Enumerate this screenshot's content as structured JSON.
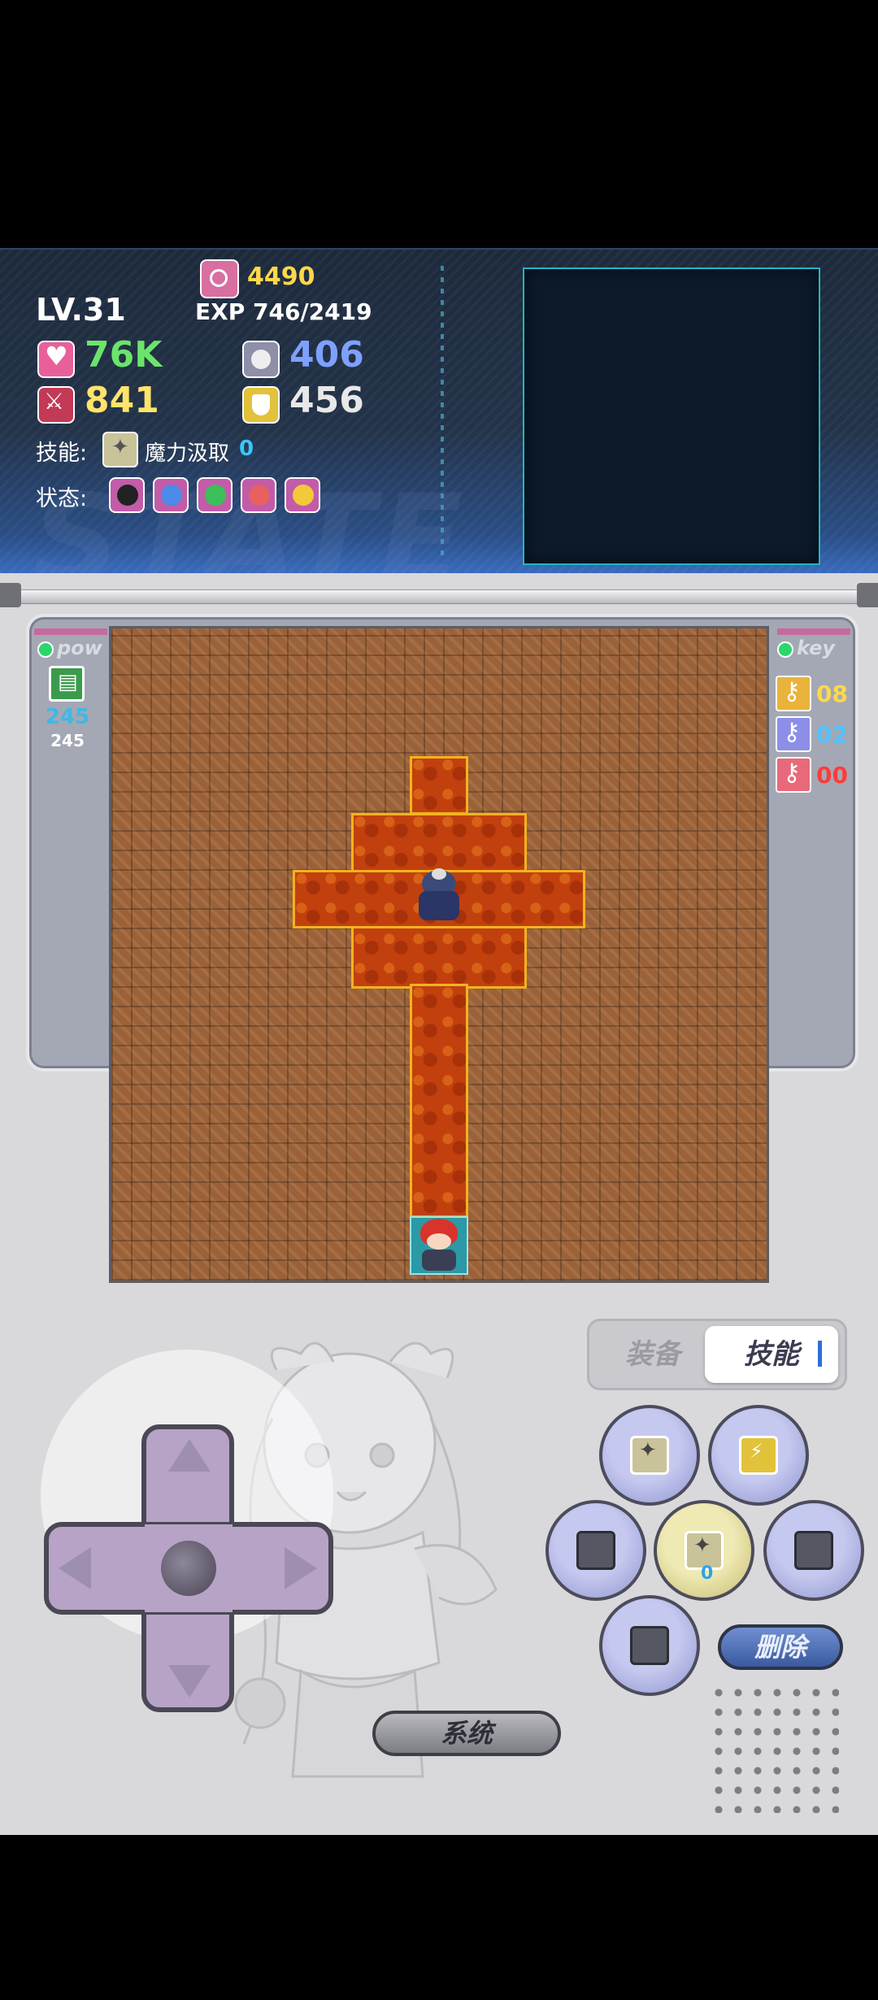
{
  "status": {
    "level": "LV.31",
    "gold": "4490",
    "exp": "EXP 746/2419",
    "hp": "76K",
    "mdef": "406",
    "atk": "841",
    "def": "456",
    "skill_label": "技能:",
    "skill_name": "魔力汲取",
    "skill_count": "0",
    "state_label": "状态:",
    "watermark": "STATE"
  },
  "side_left": {
    "title": "pow",
    "value_main": "245",
    "value_sub": "245"
  },
  "side_right": {
    "title": "key",
    "keys": [
      {
        "color": "#e9b33c",
        "count": "08",
        "count_color": "#ffd84a"
      },
      {
        "color": "#8c8ee8",
        "count": "02",
        "count_color": "#4ec3ff"
      },
      {
        "color": "#e86a7a",
        "count": "00",
        "count_color": "#ff3b3b"
      }
    ]
  },
  "tabs": {
    "equip": "装备",
    "skill": "技能"
  },
  "buttons": {
    "delete": "删除",
    "system": "系统",
    "center_skill_count": "0"
  },
  "colors": {
    "lava": "#c2400e",
    "lava_border": "#f2b21f",
    "wall": "#9b6239",
    "panel_bg": "#233349"
  }
}
